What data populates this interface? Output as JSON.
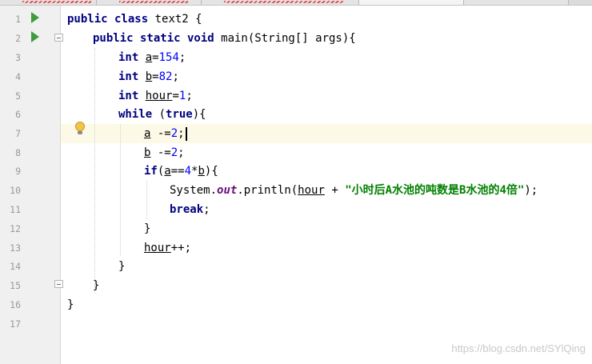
{
  "editor": {
    "line_numbers": [
      "1",
      "2",
      "3",
      "4",
      "5",
      "6",
      "7",
      "8",
      "9",
      "10",
      "11",
      "12",
      "13",
      "14",
      "15",
      "16",
      "17"
    ],
    "lines": {
      "l1": {
        "kw1": "public class",
        "name": " text2 {"
      },
      "l2": {
        "kw1": "public static void",
        "rest": " main(String[] args){"
      },
      "l3": {
        "kw": "int",
        "sp": " ",
        "var": "a",
        "op": "=",
        "num": "154",
        "end": ";"
      },
      "l4": {
        "kw": "int",
        "sp": " ",
        "var": "b",
        "op": "=",
        "num": "82",
        "end": ";"
      },
      "l5": {
        "kw": "int",
        "sp": " ",
        "var": "hour",
        "op": "=",
        "num": "1",
        "end": ";"
      },
      "l6": {
        "kw": "while",
        "open": " (",
        "kw2": "true",
        "close": "){"
      },
      "l7": {
        "var": "a",
        "op": " -=",
        "num": "2",
        "end": ";"
      },
      "l8": {
        "var": "b",
        "op": " -=",
        "num": "2",
        "end": ";"
      },
      "l9": {
        "kw": "if",
        "open": "(",
        "var": "a",
        "op": "==",
        "num": "4",
        "mul": "*",
        "var2": "b",
        "close": "){"
      },
      "l10": {
        "obj": "System.",
        "field": "out",
        "call": ".println(",
        "var": "hour",
        "plus": " + ",
        "str": "\"小时后A水池的吨数是B水池的4倍\"",
        "end": ");"
      },
      "l11": {
        "kw": "break",
        "end": ";"
      },
      "l12": {
        "text": "}"
      },
      "l13": {
        "var": "hour",
        "end": "++;"
      },
      "l14": {
        "text": "}"
      },
      "l15": {
        "text": "}"
      },
      "l16": {
        "text": "}"
      }
    }
  },
  "watermark": "https://blog.csdn.net/SYlQing",
  "icons": {
    "run": "run-icon",
    "fold": "fold-icon",
    "bulb": "lightbulb-icon"
  },
  "colors": {
    "keyword": "#000080",
    "string": "#008000",
    "number": "#0000ff",
    "field": "#660e7a",
    "line_highlight": "#fcfae6",
    "run": "#3e9c3e"
  }
}
